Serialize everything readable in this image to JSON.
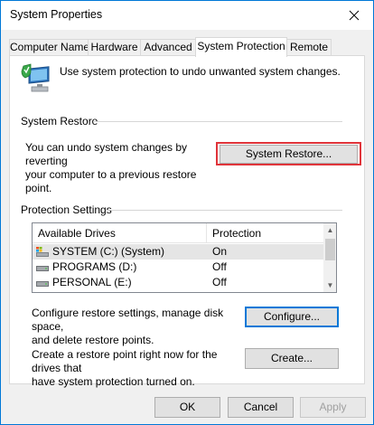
{
  "window": {
    "title": "System Properties"
  },
  "tabs": [
    {
      "label": "Computer Name",
      "active": false
    },
    {
      "label": "Hardware",
      "active": false
    },
    {
      "label": "Advanced",
      "active": false
    },
    {
      "label": "System Protection",
      "active": true
    },
    {
      "label": "Remote",
      "active": false
    }
  ],
  "intro": {
    "text": "Use system protection to undo unwanted system changes.",
    "icon": "computer-shield-icon"
  },
  "system_restore": {
    "group_label": "System Restore",
    "description_line1": "You can undo system changes by reverting",
    "description_line2": "your computer to a previous restore point.",
    "button_label": "System Restore..."
  },
  "protection": {
    "group_label": "Protection Settings",
    "columns": [
      "Available Drives",
      "Protection"
    ],
    "drives": [
      {
        "name": "SYSTEM (C:) (System)",
        "protection": "On",
        "icon": "system-drive-icon",
        "selected": true
      },
      {
        "name": "PROGRAMS (D:)",
        "protection": "Off",
        "icon": "drive-icon",
        "selected": false
      },
      {
        "name": "PERSONAL (E:)",
        "protection": "Off",
        "icon": "drive-icon",
        "selected": false
      }
    ]
  },
  "configure": {
    "description_line1": "Configure restore settings, manage disk space,",
    "description_line2": "and delete restore points.",
    "button_label": "Configure..."
  },
  "create": {
    "description_line1": "Create a restore point right now for the drives that",
    "description_line2": "have system protection turned on.",
    "button_label": "Create..."
  },
  "footer": {
    "ok_label": "OK",
    "cancel_label": "Cancel",
    "apply_label": "Apply"
  },
  "colors": {
    "accent": "#0078d7",
    "highlight_box": "#e0343a"
  }
}
